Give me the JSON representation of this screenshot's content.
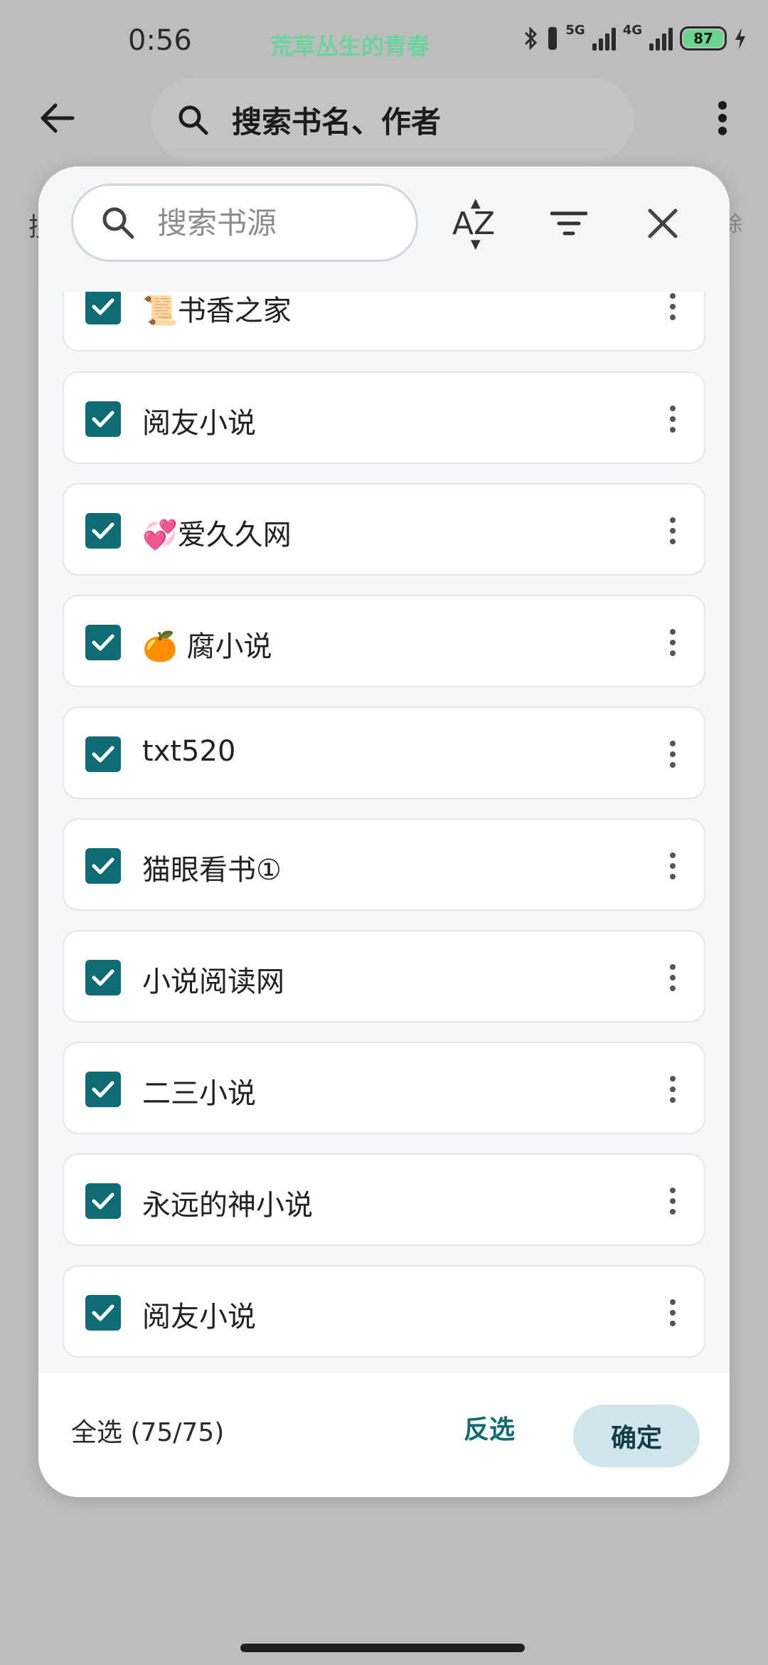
{
  "status_bar": {
    "time": "0:56",
    "song": "荒草丛生的青春",
    "net_5g": "5G",
    "net_4g": "4G",
    "battery": "87"
  },
  "app_bar": {
    "search_placeholder": "搜索书名、作者",
    "bg_left_fragment": "搜",
    "bg_right_fragment": "除"
  },
  "sheet": {
    "search_placeholder": "搜索书源",
    "sort_label": "AZ",
    "items": [
      {
        "label": "📜书香之家",
        "checked": true
      },
      {
        "label": "阅友小说",
        "checked": true
      },
      {
        "label": "💞爱久久网",
        "checked": true
      },
      {
        "label": "🍊 腐小说",
        "checked": true
      },
      {
        "label": "txt520",
        "checked": true
      },
      {
        "label": "猫眼看书①",
        "checked": true
      },
      {
        "label": "小说阅读网",
        "checked": true
      },
      {
        "label": "二三小说",
        "checked": true
      },
      {
        "label": "永远的神小说",
        "checked": true
      },
      {
        "label": "阅友小说",
        "checked": true
      }
    ],
    "footer": {
      "select_all": "全选 (75/75)",
      "invert": "反选",
      "confirm": "确定"
    }
  },
  "colors": {
    "accent": "#0f6b74",
    "confirm_bg": "#cfe6ea",
    "scrim": "#bdbdbd"
  }
}
